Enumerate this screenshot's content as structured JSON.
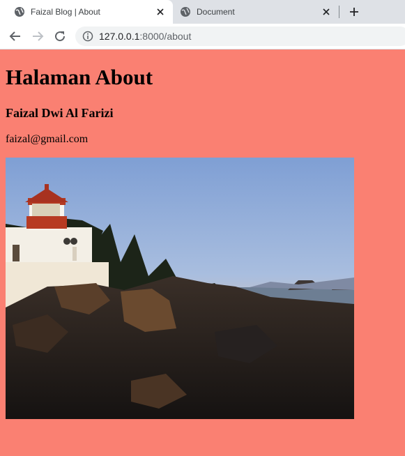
{
  "browser": {
    "tabs": [
      {
        "title": "Faizal Blog | About",
        "active": true,
        "icon": "globe-icon"
      },
      {
        "title": "Document",
        "active": false,
        "icon": "globe-icon"
      }
    ],
    "new_tab_icon": "plus-icon",
    "address": {
      "host": "127.0.0.1",
      "rest": ":8000/about"
    }
  },
  "page": {
    "heading": "Halaman About",
    "name": "Faizal Dwi Al Farizi",
    "email": "faizal@gmail.com",
    "image_subject": "lighthouse on rocky coast at sunset"
  },
  "colors": {
    "page_background": "#fa8072",
    "tabbar": "#dee1e6"
  }
}
